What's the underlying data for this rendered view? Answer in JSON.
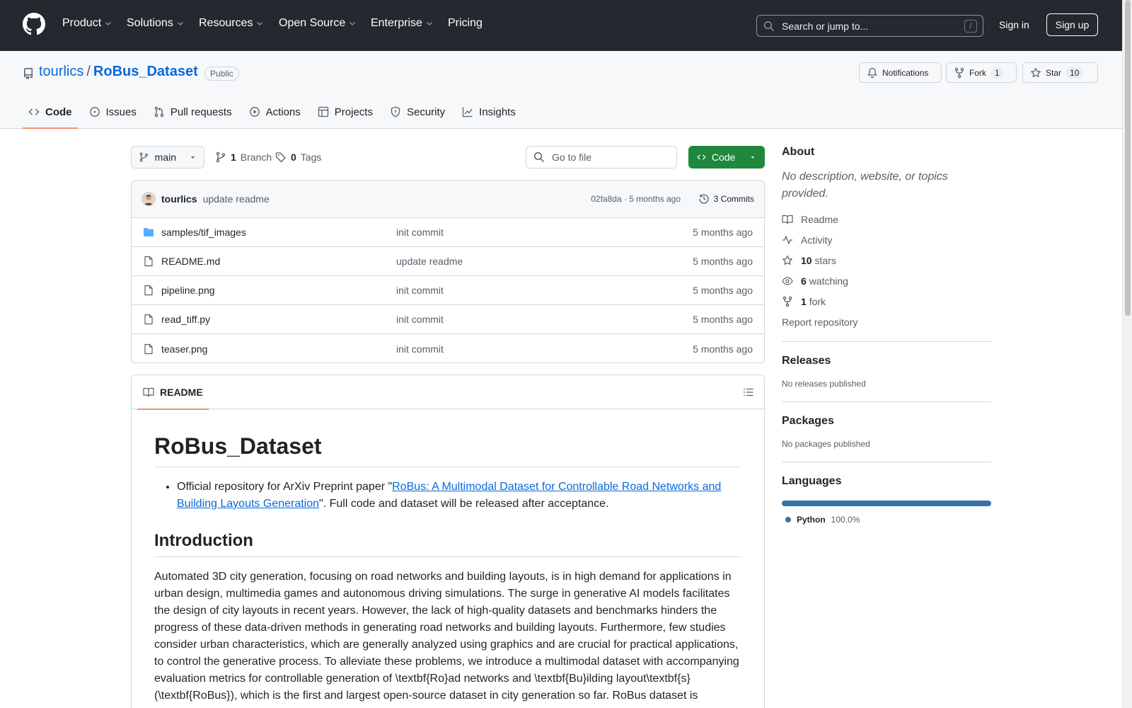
{
  "header": {
    "nav": [
      "Product",
      "Solutions",
      "Resources",
      "Open Source",
      "Enterprise",
      "Pricing"
    ],
    "search_placeholder": "Search or jump to...",
    "search_shortcut": "/",
    "signin": "Sign in",
    "signup": "Sign up"
  },
  "repo": {
    "owner": "tourlics",
    "separator": "/",
    "name": "RoBus_Dataset",
    "visibility": "Public",
    "notifications_label": "Notifications",
    "fork_label": "Fork",
    "fork_count": "1",
    "star_label": "Star",
    "star_count": "10",
    "tabs": [
      "Code",
      "Issues",
      "Pull requests",
      "Actions",
      "Projects",
      "Security",
      "Insights"
    ]
  },
  "files": {
    "branch": "main",
    "branch_count": "1",
    "branch_label": "Branch",
    "tag_count": "0",
    "tag_label": "Tags",
    "goto_placeholder": "Go to file",
    "code_button": "Code",
    "latest_commit": {
      "author": "tourlics",
      "message": "update readme",
      "meta": "02fa8da · 5 months ago",
      "commits": "3 Commits"
    },
    "rows": [
      {
        "name": "samples/tif_images",
        "commit": "init commit",
        "age": "5 months ago"
      },
      {
        "name": "README.md",
        "commit": "update readme",
        "age": "5 months ago"
      },
      {
        "name": "pipeline.png",
        "commit": "init commit",
        "age": "5 months ago"
      },
      {
        "name": "read_tiff.py",
        "commit": "init commit",
        "age": "5 months ago"
      },
      {
        "name": "teaser.png",
        "commit": "init commit",
        "age": "5 months ago"
      }
    ]
  },
  "readme": {
    "tab": "README",
    "title": "RoBus_Dataset",
    "bullet_pre": "Official repository for ArXiv Preprint paper \"",
    "bullet_link": "RoBus: A Multimodal Dataset for Controllable Road Networks and Building Layouts Generation",
    "bullet_post": "\". Full code and dataset will be released after acceptance.",
    "intro_heading": "Introduction",
    "intro_text": "Automated 3D city generation, focusing on road networks and building layouts, is in high demand for applications in urban design, multimedia games and autonomous driving simulations. The surge in generative AI models facilitates the design of city layouts in recent years. However, the lack of high-quality datasets and benchmarks hinders the progress of these data-driven methods in generating road networks and building layouts. Furthermore, few studies consider urban characteristics, which are generally analyzed using graphics and are crucial for practical applications, to control the generative process. To alleviate these problems, we introduce a multimodal dataset with accompanying evaluation metrics for controllable generation of \\textbf{Ro}ad networks and \\textbf{Bu}ilding layout\\textbf{s} (\\textbf{RoBus}), which is the first and largest open-source dataset in city generation so far. RoBus dataset is"
  },
  "sidebar": {
    "about_heading": "About",
    "about_desc": "No description, website, or topics provided.",
    "readme": "Readme",
    "activity": "Activity",
    "stars_count": "10",
    "stars_label": "stars",
    "watching_count": "6",
    "watching_label": "watching",
    "fork_count": "1",
    "fork_label": "fork",
    "report": "Report repository",
    "releases_heading": "Releases",
    "releases_text": "No releases published",
    "packages_heading": "Packages",
    "packages_text": "No packages published",
    "languages_heading": "Languages",
    "language": "Python",
    "language_pct": "100.0%"
  },
  "colors": {
    "header_bg": "#24292f",
    "link": "#0969da",
    "code_button": "#1f883d",
    "active_tab": "#fd8c73",
    "python": "#3572A5"
  }
}
